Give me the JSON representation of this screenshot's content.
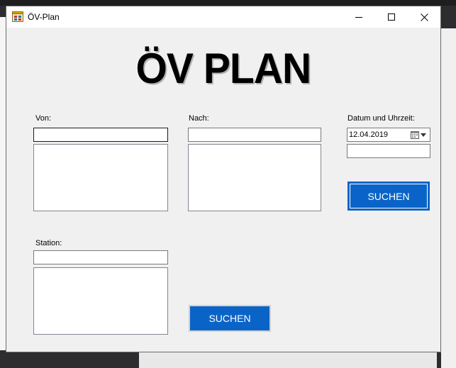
{
  "window": {
    "title": "ÖV-Plan"
  },
  "heading": "ÖV PLAN",
  "labels": {
    "from": "Von:",
    "to": "Nach:",
    "datetime": "Datum und Uhrzeit:",
    "station": "Station:"
  },
  "inputs": {
    "from": "",
    "to": "",
    "time": "",
    "station": ""
  },
  "date_picker": {
    "value": "12.04.2019"
  },
  "buttons": {
    "search_connection": "SUCHEN",
    "search_station": "SUCHEN"
  },
  "colors": {
    "accent": "#0a64c8",
    "window_bg": "#f0f0f0"
  },
  "icons": {
    "app": "app-icon",
    "calendar": "calendar-icon",
    "dropdown": "chevron-down-icon"
  }
}
